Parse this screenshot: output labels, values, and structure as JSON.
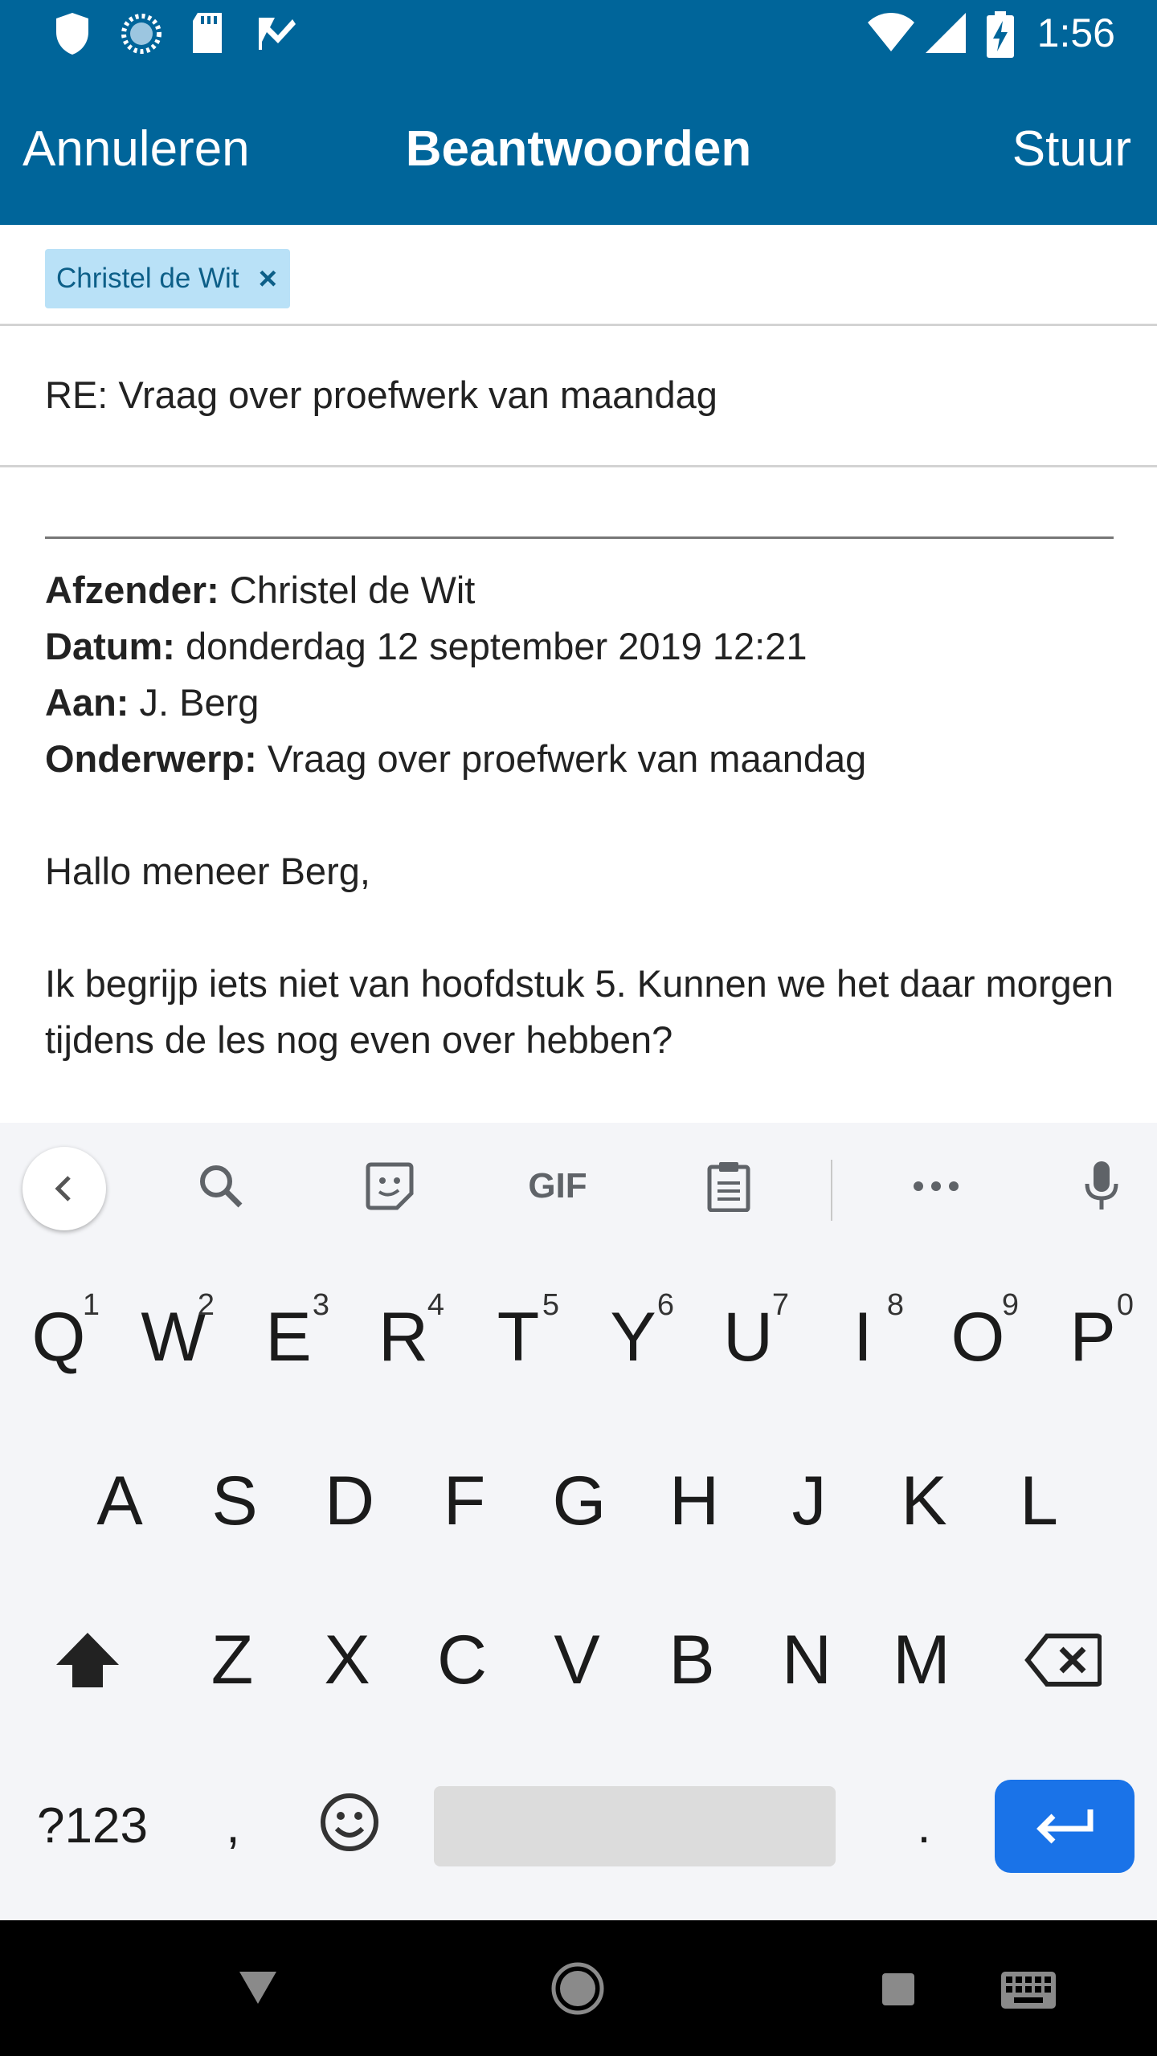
{
  "status_bar": {
    "time": "1:56",
    "icons": [
      "shield-icon",
      "sync-icon",
      "sd-card-icon",
      "task-check-icon",
      "wifi-icon",
      "signal-icon",
      "battery-charging-icon"
    ]
  },
  "app_bar": {
    "cancel_label": "Annuleren",
    "title": "Beantwoorden",
    "send_label": "Stuur"
  },
  "compose": {
    "recipient_chip": "Christel de Wit",
    "recipient_remove": "×",
    "subject": "RE: Vraag over proefwerk van maandag",
    "quoted": {
      "sender_label": "Afzender:",
      "sender_value": " Christel de Wit",
      "date_label": "Datum:",
      "date_value": " donderdag 12 september 2019 12:21",
      "to_label": "Aan:",
      "to_value": " J. Berg",
      "subject_label": "Onderwerp:",
      "subject_value": " Vraag over proefwerk van maandag"
    },
    "greeting": "Hallo meneer Berg,",
    "message": "Ik begrijp iets niet van hoofdstuk 5. Kunnen we het daar morgen tijdens de les nog even over hebben?"
  },
  "keyboard": {
    "toolbar": [
      "back-chevron-icon",
      "search-icon",
      "sticker-icon",
      "GIF",
      "clipboard-icon",
      "more-icon",
      "microphone-icon"
    ],
    "row1": [
      {
        "key": "Q",
        "sup": "1"
      },
      {
        "key": "W",
        "sup": "2"
      },
      {
        "key": "E",
        "sup": "3"
      },
      {
        "key": "R",
        "sup": "4"
      },
      {
        "key": "T",
        "sup": "5"
      },
      {
        "key": "Y",
        "sup": "6"
      },
      {
        "key": "U",
        "sup": "7"
      },
      {
        "key": "I",
        "sup": "8"
      },
      {
        "key": "O",
        "sup": "9"
      },
      {
        "key": "P",
        "sup": "0"
      }
    ],
    "row2": [
      "A",
      "S",
      "D",
      "F",
      "G",
      "H",
      "J",
      "K",
      "L"
    ],
    "row3": [
      "Z",
      "X",
      "C",
      "V",
      "B",
      "N",
      "M"
    ],
    "row4": {
      "symbols": "?123",
      "comma": ",",
      "period": "."
    }
  },
  "nav_bar": [
    "back-triangle-icon",
    "home-circle-icon",
    "recents-square-icon",
    "keyboard-icon"
  ]
}
